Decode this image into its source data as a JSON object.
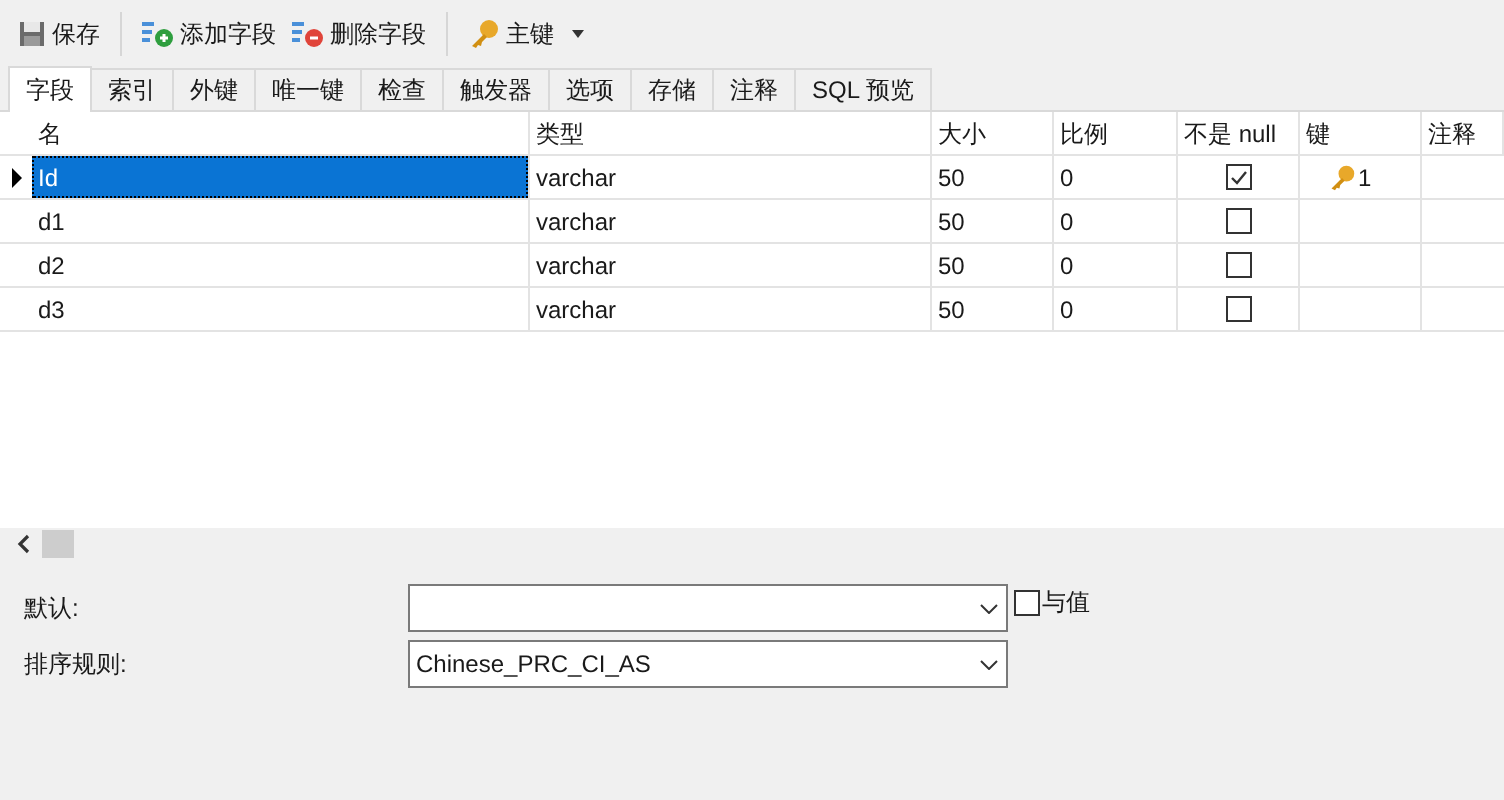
{
  "toolbar": [
    {
      "label": "保存",
      "kind": "save"
    },
    {
      "label": "添加字段",
      "kind": "add"
    },
    {
      "label": "删除字段",
      "kind": "delete"
    },
    {
      "label": "主键",
      "kind": "key",
      "dropdown": true
    }
  ],
  "tabs": [
    {
      "label": "字段",
      "selected": true
    },
    {
      "label": "索引",
      "selected": false
    },
    {
      "label": "外键",
      "selected": false
    },
    {
      "label": "唯一键",
      "selected": false
    },
    {
      "label": "检查",
      "selected": false
    },
    {
      "label": "触发器",
      "selected": false
    },
    {
      "label": "选项",
      "selected": false
    },
    {
      "label": "存储",
      "selected": false
    },
    {
      "label": "注释",
      "selected": false
    },
    {
      "label": "SQL 预览",
      "selected": false
    }
  ],
  "table": {
    "columns": [
      "名",
      "类型",
      "大小",
      "比例",
      "不是 null",
      "键",
      "注释"
    ],
    "rows": [
      {
        "name": "Id",
        "type": "varchar",
        "size": "50",
        "scale": "0",
        "not_null": true,
        "key": "1",
        "selected": true
      },
      {
        "name": "d1",
        "type": "varchar",
        "size": "50",
        "scale": "0",
        "not_null": false,
        "selected": false
      },
      {
        "name": "d2",
        "type": "varchar",
        "size": "50",
        "scale": "0",
        "not_null": false,
        "selected": false
      },
      {
        "name": "d3",
        "type": "varchar",
        "size": "50",
        "scale": "0",
        "not_null": false,
        "selected": false
      }
    ]
  },
  "properties": {
    "default": {
      "label": "默认:",
      "checkbox_label": "与值",
      "checked": false
    },
    "collation": {
      "label": "排序规则:",
      "value": "Chinese_PRC_CI_AS"
    }
  }
}
